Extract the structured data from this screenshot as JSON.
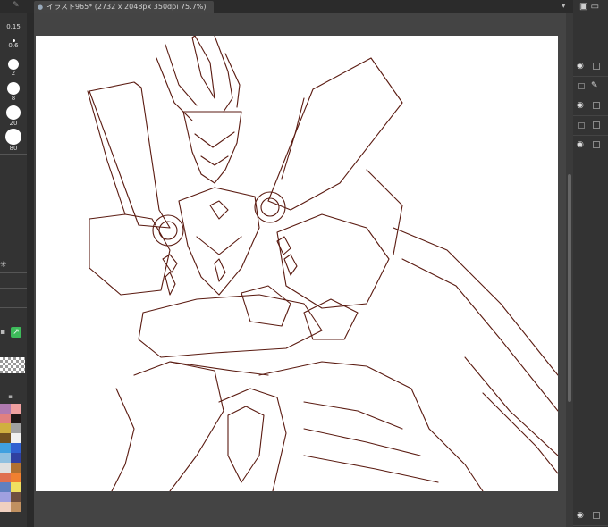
{
  "document_tab": {
    "title": "イラスト965* (2732 x 2048px 350dpi 75.7%)"
  },
  "brush_sizes": [
    {
      "label": "0.15",
      "dot": 0,
      "selected": false
    },
    {
      "label": "0.6",
      "dot": 3,
      "selected": false
    },
    {
      "label": "2",
      "dot": 12,
      "selected": false
    },
    {
      "label": "8",
      "dot": 14,
      "selected": false
    },
    {
      "label": "20",
      "dot": 16,
      "selected": false
    },
    {
      "label": "80",
      "dot": 18,
      "selected": false
    }
  ],
  "palette_colors": [
    "#b07ab0",
    "#f0a0a0",
    "#e08080",
    "#201818",
    "#d0b040",
    "#a0a0a0",
    "#705020",
    "#f0f0f0",
    "#40a0e0",
    "#3060d0",
    "#90c0e0",
    "#3040a0",
    "#e0e0e0",
    "#b07030",
    "#e07050",
    "#f08030",
    "#6080c0",
    "#f0e060",
    "#a0a0e0",
    "#705040",
    "#f0d0c0",
    "#c09060"
  ],
  "colors": {
    "panel": "#333333",
    "canvas": "#ffffff",
    "ink": "#5a1a10",
    "tab": "#454545"
  },
  "icons": [
    "close-icon",
    "menu-icon",
    "eye-icon",
    "pen-icon",
    "layer-icon",
    "sun-icon",
    "lock-icon"
  ]
}
